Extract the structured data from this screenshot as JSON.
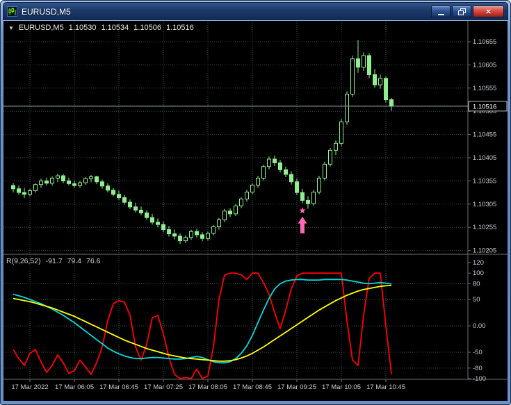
{
  "window": {
    "title": "EURUSD,M5",
    "buttons": {
      "minimize_label": "minimize",
      "restore_label": "restore",
      "close_glyph": "×"
    }
  },
  "colors": {
    "background": "#000000",
    "grid": "#2F4F4F",
    "candle": "#90EE90",
    "scale_text": "#C8D0D4",
    "axis_line": "#6F6F6F",
    "current_price_line": "#9FB2B8",
    "signal": "#FF69B4",
    "red_line": "#FF0000",
    "cyan_line": "#00DDDD",
    "yellow_line": "#FFFF00"
  },
  "symbol_header": {
    "collapse_glyph": "▼",
    "symbol": "EURUSD,M5",
    "open": "1.10530",
    "high": "1.10534",
    "low": "1.10506",
    "close": "1.10516"
  },
  "indicator_header": {
    "name": "R(9,26,52)",
    "value1": "-91.7",
    "value2": "79.4",
    "value3": "76.6"
  },
  "price_scale": [
    "1.10655",
    "1.10605",
    "1.10555",
    "1.10505",
    "1.10455",
    "1.10405",
    "1.10355",
    "1.10305",
    "1.10255",
    "1.10205"
  ],
  "current_price": "1.10516",
  "indicator_scale": [
    "120",
    "100",
    "80",
    "50",
    "0.00",
    "-50",
    "-80",
    "-100"
  ],
  "time_axis": [
    {
      "label": "17 Mar 2022",
      "index": 3
    },
    {
      "label": "17 Mar 06:05",
      "index": 11
    },
    {
      "label": "17 Mar 06:45",
      "index": 19
    },
    {
      "label": "17 Mar 07:25",
      "index": 27
    },
    {
      "label": "17 Mar 08:05",
      "index": 35
    },
    {
      "label": "17 Mar 08:45",
      "index": 43
    },
    {
      "label": "17 Mar 09:25",
      "index": 51
    },
    {
      "label": "17 Mar 10:05",
      "index": 59
    },
    {
      "label": "17 Mar 10:45",
      "index": 67
    }
  ],
  "chart_data": [
    {
      "type": "candlestick",
      "symbol": "EURUSD",
      "timeframe": "M5",
      "date": "17 Mar 2022",
      "ylim": [
        1.10197,
        1.107
      ],
      "price_gridlines": [
        1.10655,
        1.10605,
        1.10555,
        1.10505,
        1.10455,
        1.10405,
        1.10355,
        1.10305,
        1.10255,
        1.10205
      ],
      "current_price": 1.10516,
      "ohlc": [
        [
          1.10345,
          1.1035,
          1.1033,
          1.10338
        ],
        [
          1.10338,
          1.10345,
          1.10325,
          1.1033
        ],
        [
          1.1033,
          1.1034,
          1.10318,
          1.10326
        ],
        [
          1.10326,
          1.10338,
          1.10322,
          1.10334
        ],
        [
          1.10334,
          1.1035,
          1.1033,
          1.10347
        ],
        [
          1.10347,
          1.1036,
          1.1034,
          1.10355
        ],
        [
          1.10355,
          1.10362,
          1.10345,
          1.1035
        ],
        [
          1.1035,
          1.10365,
          1.10345,
          1.10361
        ],
        [
          1.10361,
          1.1037,
          1.10352,
          1.10366
        ],
        [
          1.10366,
          1.1037,
          1.1035,
          1.10355
        ],
        [
          1.10355,
          1.10362,
          1.10345,
          1.10349
        ],
        [
          1.10349,
          1.10356,
          1.1034,
          1.10345
        ],
        [
          1.10345,
          1.10355,
          1.1034,
          1.10351
        ],
        [
          1.10351,
          1.10363,
          1.10346,
          1.1036
        ],
        [
          1.1036,
          1.10368,
          1.10352,
          1.10364
        ],
        [
          1.10364,
          1.10366,
          1.10348,
          1.10353
        ],
        [
          1.10353,
          1.10358,
          1.10338,
          1.10344
        ],
        [
          1.10344,
          1.1035,
          1.1033,
          1.10335
        ],
        [
          1.10335,
          1.1034,
          1.10322,
          1.10326
        ],
        [
          1.10326,
          1.10334,
          1.10314,
          1.10319
        ],
        [
          1.10319,
          1.10325,
          1.10304,
          1.10309
        ],
        [
          1.10309,
          1.10315,
          1.10294,
          1.10299
        ],
        [
          1.10299,
          1.10308,
          1.10287,
          1.10292
        ],
        [
          1.10292,
          1.103,
          1.10281,
          1.10286
        ],
        [
          1.10286,
          1.10292,
          1.10271,
          1.10276
        ],
        [
          1.10276,
          1.10284,
          1.10261,
          1.10266
        ],
        [
          1.10266,
          1.10274,
          1.10255,
          1.10261
        ],
        [
          1.10261,
          1.10268,
          1.10244,
          1.1025
        ],
        [
          1.1025,
          1.10258,
          1.10235,
          1.10241
        ],
        [
          1.10241,
          1.1025,
          1.10229,
          1.10236
        ],
        [
          1.10236,
          1.10242,
          1.10219,
          1.10226
        ],
        [
          1.10226,
          1.10238,
          1.10221,
          1.10233
        ],
        [
          1.10233,
          1.1025,
          1.10228,
          1.10246
        ],
        [
          1.10246,
          1.10252,
          1.10233,
          1.10239
        ],
        [
          1.10239,
          1.10245,
          1.10225,
          1.10231
        ],
        [
          1.10231,
          1.10246,
          1.10226,
          1.10242
        ],
        [
          1.10242,
          1.1026,
          1.10237,
          1.10256
        ],
        [
          1.10256,
          1.10275,
          1.1025,
          1.10271
        ],
        [
          1.10271,
          1.10295,
          1.10266,
          1.1029
        ],
        [
          1.1029,
          1.10296,
          1.10277,
          1.10284
        ],
        [
          1.10284,
          1.10305,
          1.10279,
          1.10301
        ],
        [
          1.10301,
          1.1032,
          1.10296,
          1.10316
        ],
        [
          1.10316,
          1.10336,
          1.1031,
          1.10331
        ],
        [
          1.10331,
          1.1035,
          1.10326,
          1.10346
        ],
        [
          1.10346,
          1.10366,
          1.1034,
          1.10361
        ],
        [
          1.10361,
          1.1039,
          1.10356,
          1.10386
        ],
        [
          1.10386,
          1.10408,
          1.1038,
          1.10402
        ],
        [
          1.10402,
          1.1041,
          1.10387,
          1.10394
        ],
        [
          1.10394,
          1.104,
          1.10373,
          1.10379
        ],
        [
          1.10379,
          1.10386,
          1.10363,
          1.10369
        ],
        [
          1.10369,
          1.10376,
          1.10347,
          1.10353
        ],
        [
          1.10353,
          1.1036,
          1.10324,
          1.1033
        ],
        [
          1.1033,
          1.10338,
          1.10307,
          1.10313
        ],
        [
          1.10313,
          1.10322,
          1.10295,
          1.10306
        ],
        [
          1.10306,
          1.10336,
          1.10301,
          1.10331
        ],
        [
          1.10331,
          1.10366,
          1.10326,
          1.10361
        ],
        [
          1.10361,
          1.10396,
          1.10356,
          1.10391
        ],
        [
          1.10391,
          1.10426,
          1.10386,
          1.10421
        ],
        [
          1.10421,
          1.10442,
          1.10411,
          1.10436
        ],
        [
          1.10436,
          1.10488,
          1.1043,
          1.10482
        ],
        [
          1.10482,
          1.10548,
          1.10476,
          1.10542
        ],
        [
          1.10542,
          1.10625,
          1.10536,
          1.10618
        ],
        [
          1.10618,
          1.10658,
          1.10588,
          1.106
        ],
        [
          1.106,
          1.10632,
          1.10592,
          1.10625
        ],
        [
          1.10625,
          1.1063,
          1.10576,
          1.10584
        ],
        [
          1.10584,
          1.10596,
          1.10556,
          1.10562
        ],
        [
          1.10562,
          1.10584,
          1.10554,
          1.10576
        ],
        [
          1.10576,
          1.1058,
          1.10524,
          1.1053
        ],
        [
          1.1053,
          1.10534,
          1.10506,
          1.10516
        ]
      ],
      "signal": {
        "type": "buy",
        "index": 52,
        "star_price": 1.10291,
        "arrow_top_price": 1.10278,
        "arrow_bottom_price": 1.10242,
        "color": "#FF69B4"
      }
    },
    {
      "type": "line",
      "name": "R(9,26,52)",
      "current_values": [
        -91.7,
        79.4,
        76.6
      ],
      "ylim": [
        -100,
        120
      ],
      "levels": [
        80,
        50,
        0,
        -50,
        -80
      ],
      "series": [
        {
          "name": "R-fast",
          "color": "#FF0000",
          "values": [
            -45,
            -62,
            -75,
            -52,
            -45,
            -68,
            -88,
            -75,
            -55,
            -70,
            -90,
            -85,
            -65,
            -78,
            -92,
            -70,
            -40,
            10,
            42,
            48,
            45,
            20,
            -40,
            -65,
            -35,
            15,
            20,
            -15,
            -60,
            -92,
            -100,
            -98,
            -100,
            -82,
            -100,
            -95,
            -40,
            50,
            96,
            100,
            100,
            97,
            88,
            100,
            100,
            82,
            60,
            25,
            -5,
            30,
            70,
            95,
            100,
            100,
            100,
            100,
            100,
            100,
            100,
            100,
            10,
            -65,
            -75,
            20,
            90,
            100,
            100,
            0,
            -91.7
          ]
        },
        {
          "name": "R-mid",
          "color": "#00DDDD",
          "values": [
            60,
            57,
            54,
            50,
            46,
            42,
            37,
            32,
            26,
            20,
            13,
            6,
            -2,
            -10,
            -18,
            -26,
            -34,
            -42,
            -48,
            -53,
            -57,
            -60,
            -62,
            -62,
            -61,
            -60,
            -60,
            -61,
            -62,
            -63,
            -63,
            -62,
            -60,
            -58,
            -60,
            -64,
            -68,
            -70,
            -70,
            -68,
            -62,
            -52,
            -38,
            -18,
            6,
            30,
            52,
            70,
            80,
            85,
            87,
            88,
            88,
            87,
            87,
            87,
            88,
            88,
            88,
            88,
            87,
            85,
            83,
            81,
            80,
            81,
            82,
            81,
            79.4
          ]
        },
        {
          "name": "R-slow",
          "color": "#FFFF00",
          "values": [
            52,
            50,
            48,
            46,
            43,
            40,
            37,
            34,
            30,
            26,
            22,
            18,
            13,
            8,
            3,
            -2,
            -7,
            -12,
            -17,
            -22,
            -27,
            -31,
            -35,
            -39,
            -43,
            -46,
            -49,
            -52,
            -55,
            -57,
            -59,
            -61,
            -62,
            -63,
            -64,
            -65,
            -66,
            -67,
            -67,
            -66,
            -64,
            -61,
            -57,
            -52,
            -46,
            -40,
            -33,
            -26,
            -19,
            -12,
            -5,
            2,
            9,
            16,
            23,
            30,
            36,
            42,
            48,
            53,
            58,
            62,
            66,
            69,
            71,
            73,
            75,
            76,
            76.6
          ]
        }
      ]
    }
  ]
}
